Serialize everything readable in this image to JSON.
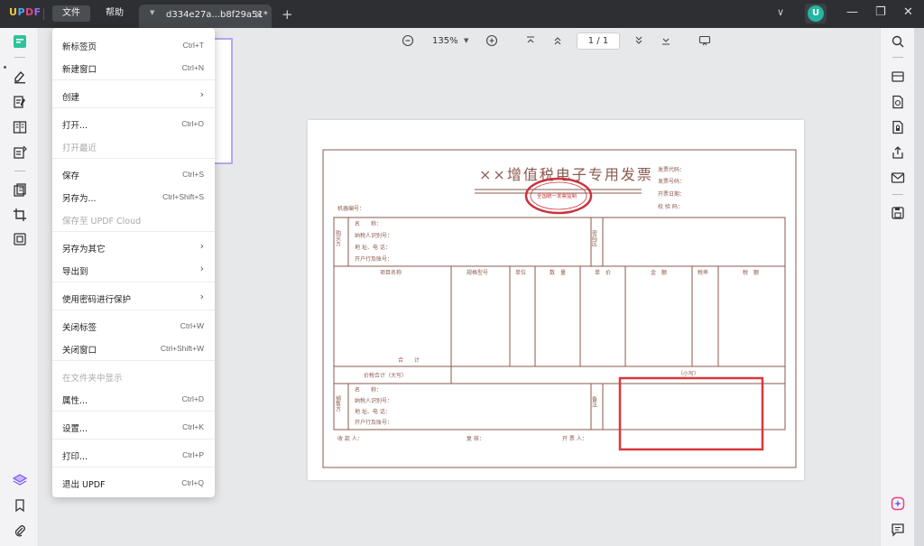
{
  "titlebar": {
    "logo_text": "UPDF",
    "menus": [
      "文件",
      "帮助"
    ],
    "tab_title": "d334e27a...b8f29a51*",
    "tab_close": "×",
    "tab_arrow": "▼",
    "new_tab": "+",
    "avatar_letter": "U",
    "win_minimize": "—",
    "win_restore": "❐",
    "win_close": "✕",
    "chevron": "∨"
  },
  "toolbar": {
    "zoom": "135%",
    "zoom_caret": "▼",
    "page_indicator": "1 / 1"
  },
  "menu": {
    "items": [
      {
        "label": "新标签页",
        "shortcut": "Ctrl+T",
        "disabled": false,
        "submenu": false
      },
      {
        "label": "新建窗口",
        "shortcut": "Ctrl+N",
        "disabled": false,
        "submenu": false
      },
      {
        "label": "创建",
        "shortcut": "",
        "disabled": false,
        "submenu": true
      },
      {
        "label": "打开...",
        "shortcut": "Ctrl+O",
        "disabled": false,
        "submenu": false
      },
      {
        "label": "打开最近",
        "shortcut": "",
        "disabled": true,
        "submenu": false
      },
      {
        "label": "保存",
        "shortcut": "Ctrl+S",
        "disabled": false,
        "submenu": false
      },
      {
        "label": "另存为...",
        "shortcut": "Ctrl+Shift+S",
        "disabled": false,
        "submenu": false
      },
      {
        "label": "保存至 UPDF Cloud",
        "shortcut": "",
        "disabled": true,
        "submenu": false
      },
      {
        "label": "另存为其它",
        "shortcut": "",
        "disabled": false,
        "submenu": true
      },
      {
        "label": "导出到",
        "shortcut": "",
        "disabled": false,
        "submenu": true
      },
      {
        "label": "使用密码进行保护",
        "shortcut": "",
        "disabled": false,
        "submenu": true
      },
      {
        "label": "关闭标签",
        "shortcut": "Ctrl+W",
        "disabled": false,
        "submenu": false
      },
      {
        "label": "关闭窗口",
        "shortcut": "Ctrl+Shift+W",
        "disabled": false,
        "submenu": false
      },
      {
        "label": "在文件夹中显示",
        "shortcut": "",
        "disabled": true,
        "submenu": false
      },
      {
        "label": "属性...",
        "shortcut": "Ctrl+D",
        "disabled": false,
        "submenu": false
      },
      {
        "label": "设置...",
        "shortcut": "Ctrl+K",
        "disabled": false,
        "submenu": false
      },
      {
        "label": "打印...",
        "shortcut": "Ctrl+P",
        "disabled": false,
        "submenu": false
      },
      {
        "label": "退出 UPDF",
        "shortcut": "Ctrl+Q",
        "disabled": false,
        "submenu": false
      }
    ]
  },
  "invoice": {
    "title": "××增值税电子专用发票",
    "seal_text": "全国统一发票监制",
    "header_right": [
      "发票代码：",
      "发票号码：",
      "开票日期：",
      "校 验 码："
    ],
    "machine_no": "机器编号：",
    "buyer_label": "购买方",
    "buyer_fields": [
      "名　　称：",
      "纳税人识别号：",
      "地 址、电 话：",
      "开户行及账号："
    ],
    "cipher_label": "密码区",
    "columns": [
      "项目名称",
      "规格型号",
      "单位",
      "数　量",
      "单　价",
      "金　额",
      "税率",
      "税　额"
    ],
    "total_label": "合　　计",
    "amount_words": "价税合计（大写）",
    "amount_small": "（小写）",
    "seller_label": "销售方",
    "seller_fields": [
      "名　　称：",
      "纳税人识别号：",
      "地 址、电 话：",
      "开户行及账号："
    ],
    "remark_label": "备注",
    "footer": [
      "收 款 人：",
      "复 核：",
      "开 票 人："
    ],
    "colors": {
      "ink": "#8a5a4e",
      "seal": "#c8343c",
      "highlight": "#d9383c"
    }
  },
  "colors": {
    "titlebar_bg": "#2d2f33",
    "logo_u": "#f2c744",
    "logo_p": "#4da3f5",
    "logo_d": "#e8417b",
    "logo_f": "#9b6bf2",
    "accent": "#7b5cf0"
  }
}
